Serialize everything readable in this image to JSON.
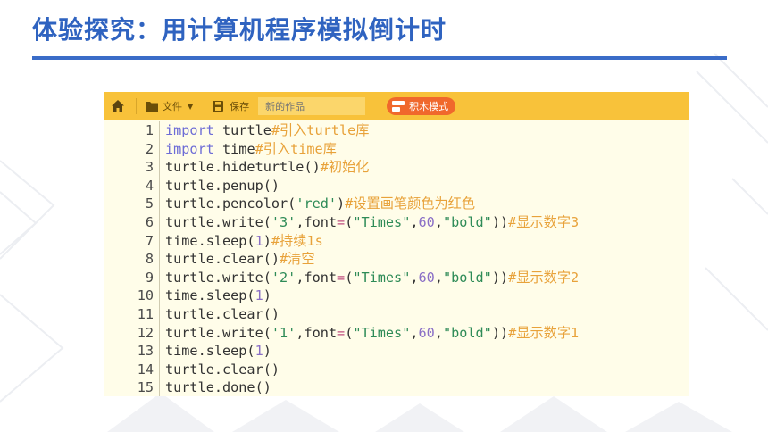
{
  "slide": {
    "title": "体验探究：用计算机程序模拟倒计时"
  },
  "toolbar": {
    "home_icon": "home-icon",
    "file_label": "文件",
    "save_label": "保存",
    "project_name_placeholder": "新的作品",
    "block_mode_label": "积木模式"
  },
  "colors": {
    "title": "#2f63c0",
    "toolbar": "#f8c23a",
    "block_button": "#f0682c",
    "editor_bg": "#fffde9",
    "keyword": "#6d6cd6",
    "comment": "#e8a23a",
    "string": "#2e8b57"
  },
  "code": {
    "lines": [
      {
        "n": "1",
        "tokens": [
          {
            "t": "kw",
            "v": "import"
          },
          {
            "t": "txt",
            "v": " turtle"
          },
          {
            "t": "cm",
            "v": "#引入turtle库"
          }
        ]
      },
      {
        "n": "2",
        "tokens": [
          {
            "t": "kw",
            "v": "import"
          },
          {
            "t": "txt",
            "v": " time"
          },
          {
            "t": "cm",
            "v": "#引入time库"
          }
        ]
      },
      {
        "n": "3",
        "tokens": [
          {
            "t": "txt",
            "v": "turtle.hideturtle()"
          },
          {
            "t": "cm",
            "v": "#初始化"
          }
        ]
      },
      {
        "n": "4",
        "tokens": [
          {
            "t": "txt",
            "v": "turtle.penup()"
          }
        ]
      },
      {
        "n": "5",
        "tokens": [
          {
            "t": "txt",
            "v": "turtle.pencolor("
          },
          {
            "t": "str",
            "v": "'red'"
          },
          {
            "t": "txt",
            "v": ")"
          },
          {
            "t": "cm",
            "v": "#设置画笔颜色为红色"
          }
        ]
      },
      {
        "n": "6",
        "tokens": [
          {
            "t": "txt",
            "v": "turtle.write("
          },
          {
            "t": "str",
            "v": "'3'"
          },
          {
            "t": "txt",
            "v": ",font"
          },
          {
            "t": "op",
            "v": "="
          },
          {
            "t": "txt",
            "v": "("
          },
          {
            "t": "str",
            "v": "\"Times\""
          },
          {
            "t": "txt",
            "v": ","
          },
          {
            "t": "num",
            "v": "60"
          },
          {
            "t": "txt",
            "v": ","
          },
          {
            "t": "str",
            "v": "\"bold\""
          },
          {
            "t": "txt",
            "v": "))"
          },
          {
            "t": "cm",
            "v": "#显示数字3"
          }
        ]
      },
      {
        "n": "7",
        "tokens": [
          {
            "t": "txt",
            "v": "time.sleep("
          },
          {
            "t": "num",
            "v": "1"
          },
          {
            "t": "txt",
            "v": ")"
          },
          {
            "t": "cm",
            "v": "#持续1s"
          }
        ]
      },
      {
        "n": "8",
        "tokens": [
          {
            "t": "txt",
            "v": "turtle.clear()"
          },
          {
            "t": "cm",
            "v": "#清空"
          }
        ]
      },
      {
        "n": "9",
        "tokens": [
          {
            "t": "txt",
            "v": "turtle.write("
          },
          {
            "t": "str",
            "v": "'2'"
          },
          {
            "t": "txt",
            "v": ",font"
          },
          {
            "t": "op",
            "v": "="
          },
          {
            "t": "txt",
            "v": "("
          },
          {
            "t": "str",
            "v": "\"Times\""
          },
          {
            "t": "txt",
            "v": ","
          },
          {
            "t": "num",
            "v": "60"
          },
          {
            "t": "txt",
            "v": ","
          },
          {
            "t": "str",
            "v": "\"bold\""
          },
          {
            "t": "txt",
            "v": "))"
          },
          {
            "t": "cm",
            "v": "#显示数字2"
          }
        ]
      },
      {
        "n": "10",
        "tokens": [
          {
            "t": "txt",
            "v": "time.sleep("
          },
          {
            "t": "num",
            "v": "1"
          },
          {
            "t": "txt",
            "v": ")"
          }
        ]
      },
      {
        "n": "11",
        "tokens": [
          {
            "t": "txt",
            "v": "turtle.clear()"
          }
        ]
      },
      {
        "n": "12",
        "tokens": [
          {
            "t": "txt",
            "v": "turtle.write("
          },
          {
            "t": "str",
            "v": "'1'"
          },
          {
            "t": "txt",
            "v": ",font"
          },
          {
            "t": "op",
            "v": "="
          },
          {
            "t": "txt",
            "v": "("
          },
          {
            "t": "str",
            "v": "\"Times\""
          },
          {
            "t": "txt",
            "v": ","
          },
          {
            "t": "num",
            "v": "60"
          },
          {
            "t": "txt",
            "v": ","
          },
          {
            "t": "str",
            "v": "\"bold\""
          },
          {
            "t": "txt",
            "v": "))"
          },
          {
            "t": "cm",
            "v": "#显示数字1"
          }
        ]
      },
      {
        "n": "13",
        "tokens": [
          {
            "t": "txt",
            "v": "time.sleep("
          },
          {
            "t": "num",
            "v": "1"
          },
          {
            "t": "txt",
            "v": ")"
          }
        ]
      },
      {
        "n": "14",
        "tokens": [
          {
            "t": "txt",
            "v": "turtle.clear()"
          }
        ]
      },
      {
        "n": "15",
        "tokens": [
          {
            "t": "txt",
            "v": "turtle.done()"
          }
        ]
      }
    ]
  }
}
